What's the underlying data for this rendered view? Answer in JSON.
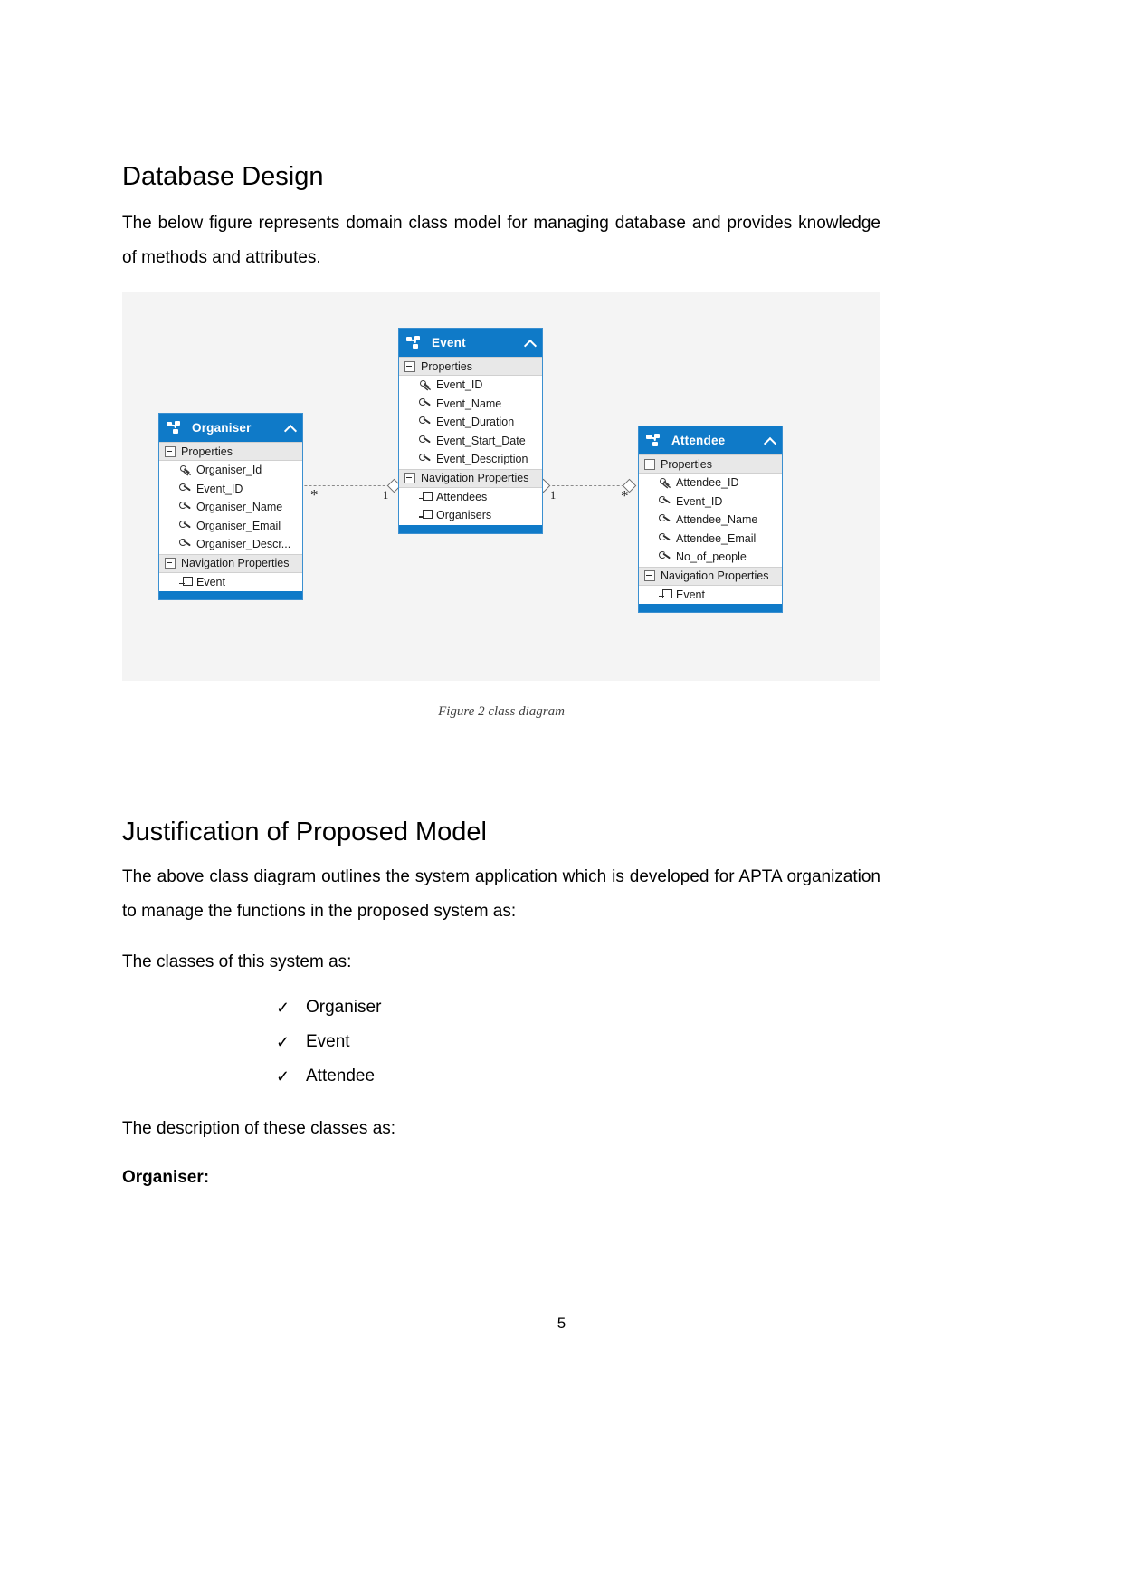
{
  "document": {
    "page_number": "5",
    "headings": {
      "database_design": "Database Design",
      "justification": "Justification of Proposed Model"
    },
    "paragraphs": {
      "intro": "The below figure represents domain class model for managing database and provides knowledge of methods and attributes.",
      "above_diagram": "The above class diagram outlines the system application which is developed for APTA organization to manage the functions in the proposed system as:",
      "classes_lead": "The classes of this system as:",
      "description_lead": "The description of these classes as:",
      "organiser_label": "Organiser:"
    },
    "class_list": [
      {
        "tick": "✓",
        "label": "Organiser"
      },
      {
        "tick": "✓",
        "label": "Event"
      },
      {
        "tick": "✓",
        "label": "Attendee"
      }
    ],
    "figure": {
      "caption": "Figure 2 class diagram",
      "accent_color": "#0f7ac8",
      "canvas_color": "#f4f4f4",
      "classes": [
        {
          "name": "Organiser",
          "icon": "class-icon",
          "collapse_icon": "chevron-up-icon",
          "sections": [
            {
              "title": "Properties",
              "rows": [
                {
                  "icon": "key-icon",
                  "label": "Organiser_Id"
                },
                {
                  "icon": "wrench-icon",
                  "label": "Event_ID"
                },
                {
                  "icon": "wrench-icon",
                  "label": "Organiser_Name"
                },
                {
                  "icon": "wrench-icon",
                  "label": "Organiser_Email"
                },
                {
                  "icon": "wrench-icon",
                  "label": "Organiser_Descr..."
                }
              ]
            },
            {
              "title": "Navigation Properties",
              "rows": [
                {
                  "icon": "navigation-icon",
                  "label": "Event"
                }
              ]
            }
          ]
        },
        {
          "name": "Event",
          "icon": "class-icon",
          "collapse_icon": "chevron-up-icon",
          "sections": [
            {
              "title": "Properties",
              "rows": [
                {
                  "icon": "key-icon",
                  "label": "Event_ID"
                },
                {
                  "icon": "wrench-icon",
                  "label": "Event_Name"
                },
                {
                  "icon": "wrench-icon",
                  "label": "Event_Duration"
                },
                {
                  "icon": "wrench-icon",
                  "label": "Event_Start_Date"
                },
                {
                  "icon": "wrench-icon",
                  "label": "Event_Description"
                }
              ]
            },
            {
              "title": "Navigation Properties",
              "rows": [
                {
                  "icon": "navigation-icon",
                  "label": "Attendees"
                },
                {
                  "icon": "navigation-icon",
                  "label": "Organisers"
                }
              ]
            }
          ]
        },
        {
          "name": "Attendee",
          "icon": "class-icon",
          "collapse_icon": "chevron-up-icon",
          "sections": [
            {
              "title": "Properties",
              "rows": [
                {
                  "icon": "key-icon",
                  "label": "Attendee_ID"
                },
                {
                  "icon": "wrench-icon",
                  "label": "Event_ID"
                },
                {
                  "icon": "wrench-icon",
                  "label": "Attendee_Name"
                },
                {
                  "icon": "wrench-icon",
                  "label": "Attendee_Email"
                },
                {
                  "icon": "wrench-icon",
                  "label": "No_of_people"
                }
              ]
            },
            {
              "title": "Navigation Properties",
              "rows": [
                {
                  "icon": "navigation-icon",
                  "label": "Event"
                }
              ]
            }
          ]
        }
      ],
      "associations": [
        {
          "from": "Organiser",
          "to": "Event",
          "from_multiplicity": "*",
          "to_multiplicity": "1"
        },
        {
          "from": "Event",
          "to": "Attendee",
          "from_multiplicity": "1",
          "to_multiplicity": "*"
        }
      ]
    }
  }
}
